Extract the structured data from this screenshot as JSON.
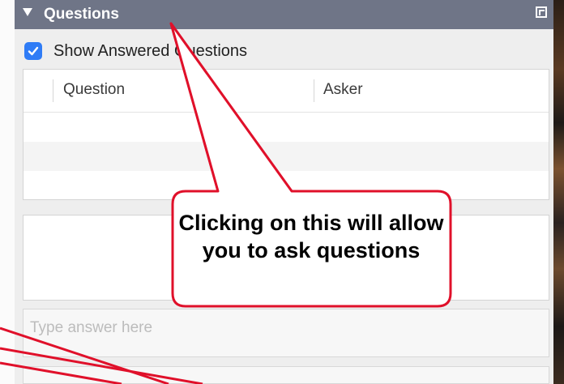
{
  "panel": {
    "title": "Questions",
    "icons": {
      "collapse": "triangle-down-icon",
      "popout": "popout-icon",
      "checkbox": "checkmark-icon"
    }
  },
  "options": {
    "show_answered_label": "Show Answered Questions",
    "show_answered_checked": true
  },
  "table": {
    "columns": [
      "Question",
      "Asker"
    ],
    "rows": []
  },
  "answer": {
    "placeholder": "Type answer here",
    "value": ""
  },
  "callout": {
    "text": "Clicking on this will allow you to ask questions"
  },
  "colors": {
    "titlebar": "#6f7587",
    "checkbox": "#2f7cf6",
    "callout_border": "#e0102a"
  }
}
